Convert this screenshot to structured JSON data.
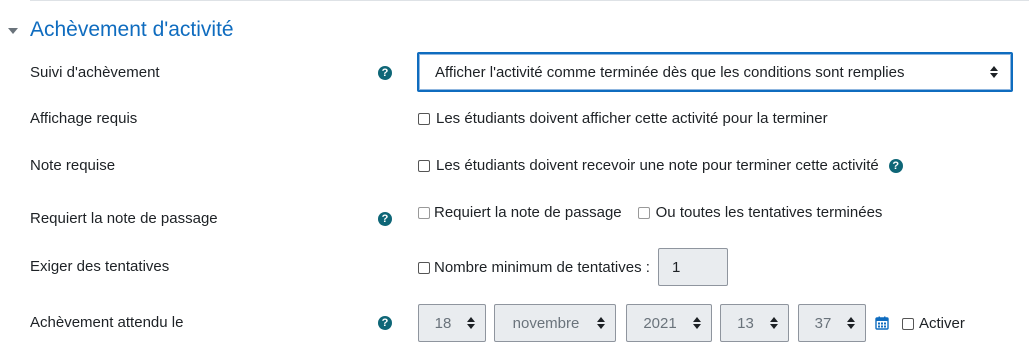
{
  "section": {
    "title": "Achèvement d'activité"
  },
  "rows": {
    "completion_tracking": {
      "label": "Suivi d'achèvement",
      "value": "Afficher l'activité comme terminée dès que les conditions sont remplies"
    },
    "view_required": {
      "label": "Affichage requis",
      "checkbox_label": "Les étudiants doivent afficher cette activité pour la terminer"
    },
    "grade_required": {
      "label": "Note requise",
      "checkbox_label": "Les étudiants doivent recevoir une note pour terminer cette activité"
    },
    "pass_grade": {
      "label": "Requiert la note de passage",
      "checkbox_pass": "Requiert la note de passage",
      "checkbox_all_attempts": "Ou toutes les tentatives terminées"
    },
    "attempts": {
      "label": "Exiger des tentatives",
      "checkbox_label": "Nombre minimum de tentatives :",
      "value": "1"
    },
    "expected": {
      "label": "Achèvement attendu le",
      "day": "18",
      "month": "novembre",
      "year": "2021",
      "hour": "13",
      "minute": "37",
      "enable_label": "Activer"
    }
  },
  "icons": {
    "help": "?",
    "help_icon": "question-circle-icon",
    "calendar_icon": "calendar-icon",
    "caret_icon": "caret-down-icon"
  },
  "colors": {
    "accent": "#0f6cbf",
    "help": "#0e6677",
    "disabled_bg": "#e9ecef"
  }
}
